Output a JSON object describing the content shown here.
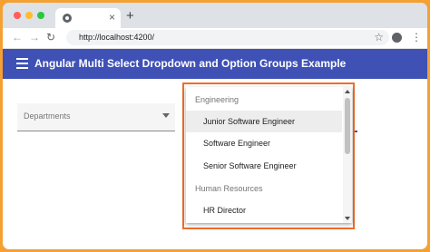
{
  "browser": {
    "tab": {
      "close_glyph": "×"
    },
    "new_tab_glyph": "+",
    "nav": {
      "back_glyph": "←",
      "forward_glyph": "→",
      "reload_glyph": "↻"
    },
    "url": "http://localhost:4200/",
    "bookmark_glyph": "☆",
    "menu_glyph": "⋮"
  },
  "app": {
    "title": "Angular Multi Select Dropdown and Option Groups Example",
    "toolbar_color": "#3f51b5"
  },
  "select": {
    "label": "Departments"
  },
  "dropdown": {
    "groups": [
      {
        "label": "Engineering"
      },
      {
        "label": "Human Resources"
      }
    ],
    "options": [
      {
        "label": "Junior Software Engineer",
        "active": true
      },
      {
        "label": "Software Engineer"
      },
      {
        "label": "Senior Software Engineer"
      },
      {
        "label": "HR Director"
      }
    ]
  },
  "colors": {
    "frame": "#f4a033",
    "highlight": "#f06e28"
  }
}
